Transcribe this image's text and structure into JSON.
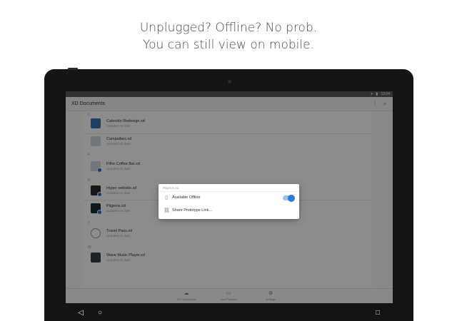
{
  "headline": {
    "line1": "Unplugged? Offline? No prob.",
    "line2": "You can still view on mobile."
  },
  "statusbar": {
    "time": "13:04",
    "wifi_icon": "wifi-icon",
    "battery_icon": "battery-icon"
  },
  "appbar": {
    "title": "XD Documents",
    "more_icon": "more-vert-icon",
    "search_icon": "search-icon"
  },
  "files": [
    {
      "section": "C",
      "name": "Calendio Redesign.xd",
      "date": "Updated on date",
      "thumb": "blue",
      "offline": false
    },
    {
      "section": "",
      "name": "Campaibes.xd",
      "date": "Updated on date",
      "thumb": "light",
      "offline": false
    },
    {
      "section": "F",
      "name": "Fithe Coffee Bar.xd",
      "date": "Updated on date",
      "thumb": "light",
      "offline": true
    },
    {
      "section": "H",
      "name": "Hyper website.xd",
      "date": "Updated on date",
      "thumb": "photo",
      "offline": true
    },
    {
      "section": "",
      "name": "Pilgems.xd",
      "date": "Updated on date",
      "thumb": "dark",
      "offline": true
    },
    {
      "section": "T",
      "name": "Travel Pass.xd",
      "date": "Updated on date",
      "thumb": "clock",
      "offline": false
    },
    {
      "section": "W",
      "name": "Wave Music Player.xd",
      "date": "Updated on date",
      "thumb": "band",
      "offline": false
    }
  ],
  "bottomnav": [
    {
      "label": "XD Documents",
      "icon": "cloud-icon"
    },
    {
      "label": "Live Preview",
      "icon": "preview-icon"
    },
    {
      "label": "Settings",
      "icon": "gear-icon"
    }
  ],
  "dialog": {
    "title": "Pilgems.xd",
    "available_offline": {
      "label": "Available Offline",
      "icon": "document-icon",
      "enabled": true
    },
    "share_link": {
      "label": "Share Prototype Link...",
      "icon": "link-icon"
    }
  },
  "colors": {
    "accent": "#2b78d6",
    "offline_badge": "#1f6fd0"
  }
}
